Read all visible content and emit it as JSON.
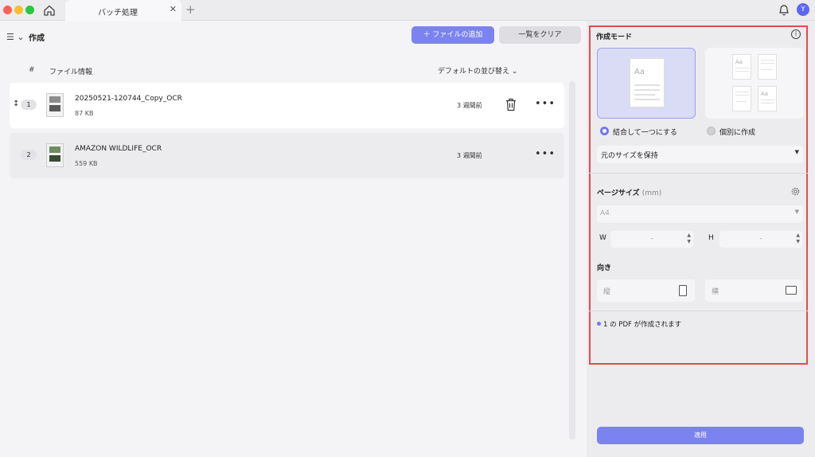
{
  "titlebar": {
    "tab_title": "バッチ処理",
    "tab_close": "✕",
    "tab_add": "+",
    "avatar_initial": "Y"
  },
  "toolbar": {
    "menu_icon": "☰ ⌄",
    "title": "作成",
    "add_files_label": "＋ ファイルの追加",
    "clear_label": "一覧をクリア"
  },
  "list": {
    "col_hash": "#",
    "col_file": "ファイル情報",
    "sort_label": "デフォルトの並び替え ⌄",
    "items": [
      {
        "index": "1",
        "name": "20250521-120744_Copy_OCR",
        "size": "87 KB",
        "time": "3 週間前"
      },
      {
        "index": "2",
        "name": "AMAZON WILDLIFE_OCR",
        "size": "559 KB",
        "time": "3 週間前"
      }
    ],
    "drag_handle": "↕",
    "more": "•••"
  },
  "panel": {
    "mode_title": "作成モード",
    "info_icon": "i",
    "combine_label": "結合して一つにする",
    "separate_label": "個別に作成",
    "thumbnail_text": "Aa",
    "size_select": "元のサイズを保持",
    "page_size_label": "ページサイズ",
    "page_size_unit": "(mm)",
    "paper_select": "A4",
    "w_label": "W",
    "h_label": "H",
    "w_value": "-",
    "h_value": "-",
    "orientation_label": "向き",
    "portrait_label": "縦",
    "landscape_label": "横",
    "pdf_note": "1 の PDF が作成されます",
    "apply_label": "適用"
  }
}
